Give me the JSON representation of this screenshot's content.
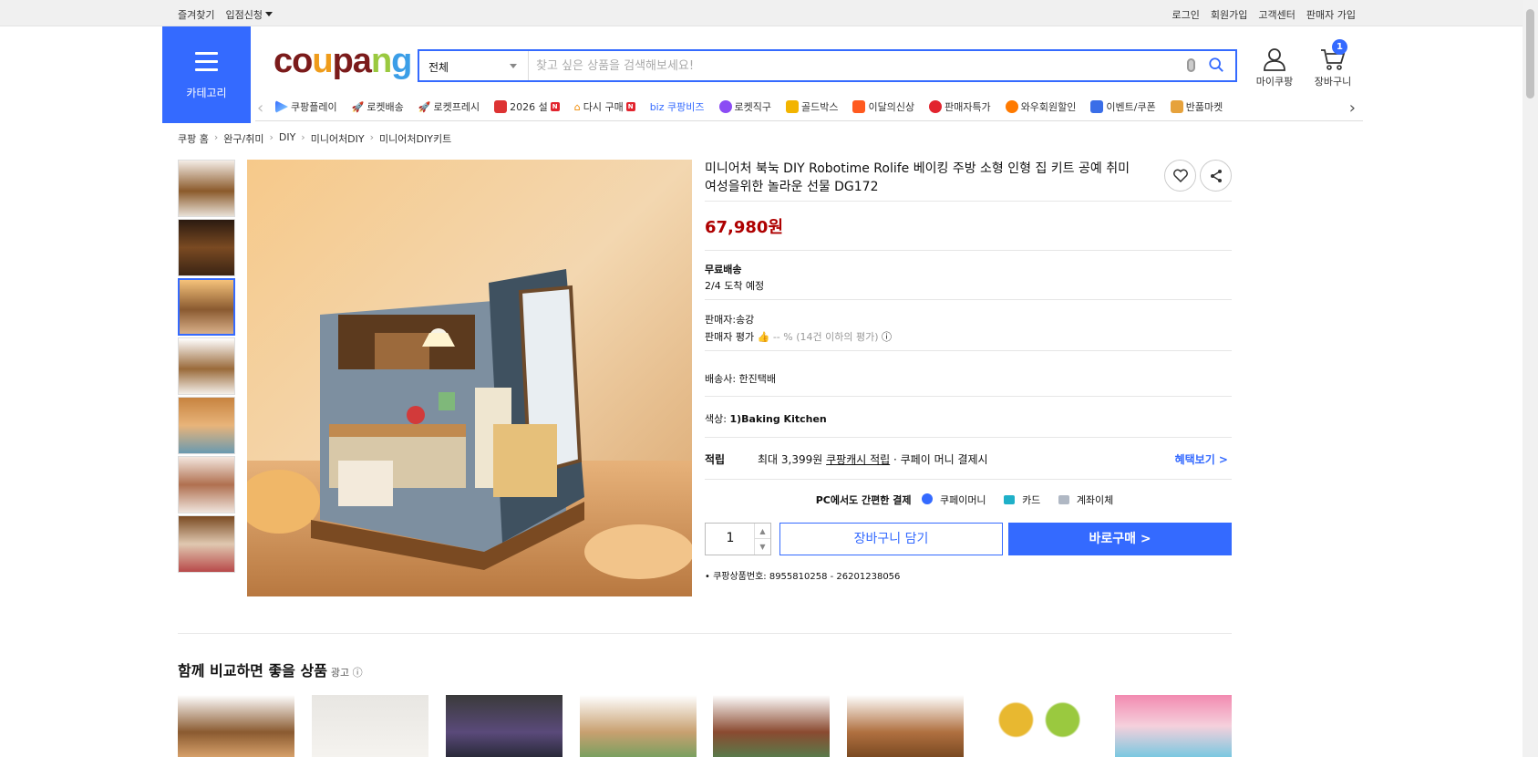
{
  "topbar": {
    "left": [
      "즐겨찾기",
      "입점신청"
    ],
    "right": [
      "로그인",
      "회원가입",
      "고객센터",
      "판매자 가입"
    ]
  },
  "header": {
    "category_label": "카테고리",
    "logo": "coupang",
    "search_category": "전체",
    "search_placeholder": "찾고 싶은 상품을 검색해보세요!",
    "my_coupang": "마이쿠팡",
    "cart_label": "장바구니",
    "cart_count": "1"
  },
  "nav": {
    "items": [
      "쿠팡플레이",
      "로켓배송",
      "로켓프레시",
      "2026 설",
      "다시 구매",
      "biz 쿠팡비즈",
      "로켓직구",
      "골드박스",
      "이달의신상",
      "판매자특가",
      "와우회원할인",
      "이벤트/쿠폰",
      "반품마켓"
    ]
  },
  "breadcrumb": [
    "쿠팡 홈",
    "완구/취미",
    "DIY",
    "미니어처DIY",
    "미니어처DIY키트"
  ],
  "product": {
    "title": "미니어처 북눅 DIY Robotime Rolife 베이킹 주방 소형 인형 집 키트 공예 취미 여성을위한 놀라운 선물 DG172",
    "price": "67,980원",
    "shipping_title": "무료배송",
    "arrival": "2/4 도착 예정",
    "seller": "판매자:송강",
    "seller_rating_label": "판매자 평가",
    "seller_rating_value": "-- % (14건 이하의 평가)",
    "carrier": "배송사:  한진택배",
    "color_label": "색상:",
    "color_value": "1)Baking Kitchen",
    "reward_label": "적립",
    "reward_prefix": "최대 3,399원",
    "reward_link": "쿠팡캐시 적립",
    "reward_suffix": "· 쿠페이 머니 결제시",
    "benefit_link": "혜택보기 >",
    "pay_title": "PC에서도 간편한 결제",
    "pay_methods": [
      "쿠페이머니",
      "카드",
      "계좌이체"
    ],
    "quantity": "1",
    "add_to_cart": "장바구니 담기",
    "buy_now": "바로구매 >",
    "product_id": "쿠팡상품번호: 8955810258 - 26201238056"
  },
  "compare": {
    "title": "함께 비교하면 좋을 상품",
    "ad_label": "광고 ⓘ"
  },
  "colors": {
    "accent": "#346aff",
    "price": "#ae0000"
  }
}
